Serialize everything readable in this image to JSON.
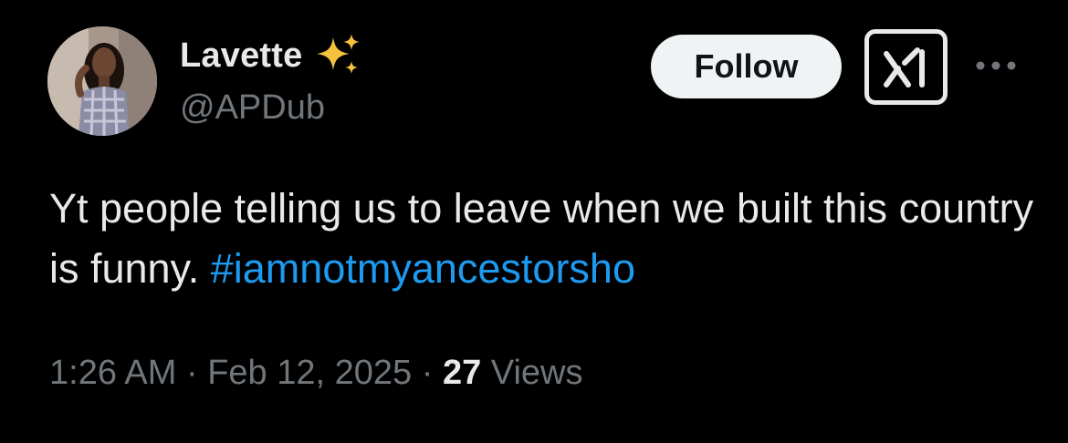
{
  "author": {
    "display_name": "Lavette",
    "handle": "@APDub",
    "avatar_icon": "profile-photo",
    "badge_icon": "sparkles-emoji"
  },
  "actions": {
    "follow_label": "Follow",
    "grok_icon": "grok-icon",
    "more_icon": "more-dots-icon"
  },
  "tweet": {
    "text_before": "Yt people telling us to leave when we built this country is funny. ",
    "hashtag": "#iamnotmyancestorsho"
  },
  "meta": {
    "time": "1:26 AM",
    "separator": " · ",
    "date": "Feb 12, 2025",
    "views_count": "27",
    "views_label": " Views"
  },
  "colors": {
    "background": "#000000",
    "text_primary": "#e7e9ea",
    "text_secondary": "#71767b",
    "link": "#1d9bf0",
    "follow_bg": "#eff3f4",
    "sparkle": "#f6c23e"
  }
}
